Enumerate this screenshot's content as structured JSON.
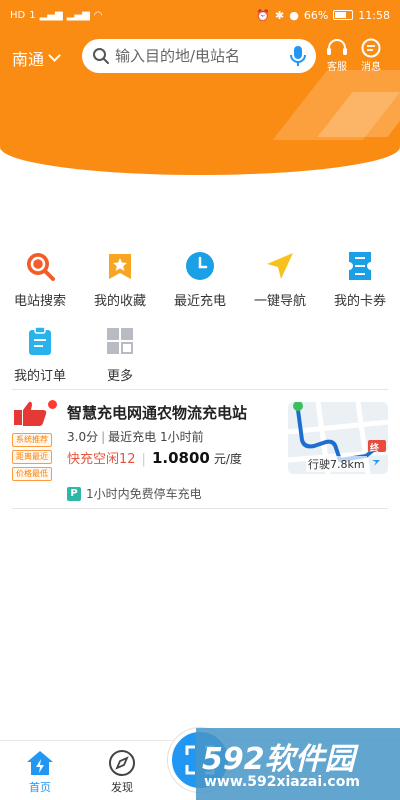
{
  "status_bar": {
    "left_badges": [
      "HD",
      "1",
      "⁴⁶",
      "⁴⁶"
    ],
    "battery": "66%",
    "time": "11:58"
  },
  "header": {
    "city": "南通",
    "search": {
      "placeholder": "输入目的地/电站名"
    },
    "customer_service": "客服",
    "messages": "消息"
  },
  "menu": [
    {
      "label": "电站搜索",
      "icon": "station-search-icon"
    },
    {
      "label": "我的收藏",
      "icon": "favorites-icon"
    },
    {
      "label": "最近充电",
      "icon": "recent-charge-icon"
    },
    {
      "label": "一键导航",
      "icon": "navigation-icon"
    },
    {
      "label": "我的卡券",
      "icon": "coupon-icon"
    },
    {
      "label": "我的订单",
      "icon": "orders-icon"
    },
    {
      "label": "更多",
      "icon": "more-icon"
    }
  ],
  "station": {
    "tags": [
      "系统推荐",
      "距离最近",
      "价格最低"
    ],
    "name": "智慧充电网通农物流充电站",
    "rating": "3.0分",
    "recent": "最近充电 1小时前",
    "fast_status": "快充空闲12",
    "price": "1.0800",
    "price_unit": "元/度",
    "distance": "行驶7.8km",
    "map_end_label": "终",
    "parking_badge": "P",
    "parking": "1小时内免费停车充电"
  },
  "bottom_nav": {
    "home": "首页",
    "discover": "发现"
  },
  "watermark": {
    "brand": "592软件园",
    "url": "www.592xiazai.com"
  },
  "colors": {
    "brand_orange": "#fb8c13",
    "accent_blue": "#2196f3",
    "price_red": "#e4573f"
  }
}
